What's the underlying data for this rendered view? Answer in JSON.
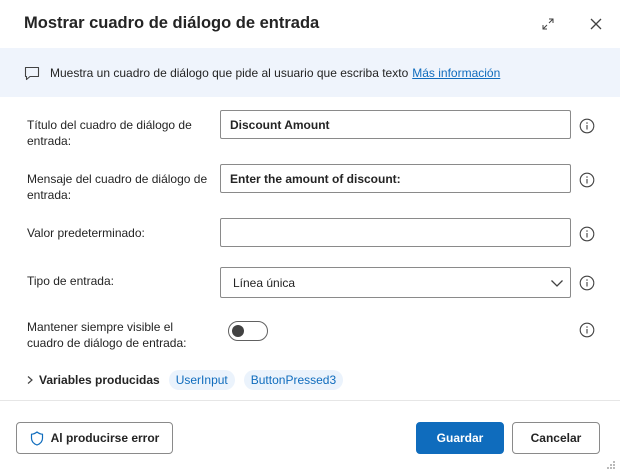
{
  "dialog": {
    "title": "Mostrar cuadro de diálogo de entrada",
    "expand_icon": "expand-icon",
    "close_icon": "close-icon"
  },
  "banner": {
    "icon": "comment-icon",
    "text": "Muestra un cuadro de diálogo que pide al usuario que escriba texto",
    "link": "Más información"
  },
  "fields": {
    "title": {
      "label": "Título del cuadro de diálogo de entrada:",
      "value": "Discount Amount"
    },
    "message": {
      "label": "Mensaje del cuadro de diálogo de entrada:",
      "value": "Enter the amount of discount:"
    },
    "default_value": {
      "label": "Valor predeterminado:",
      "value": ""
    },
    "input_type": {
      "label": "Tipo de entrada:",
      "value": "Línea única"
    },
    "keep_visible": {
      "label": "Mantener siempre visible el cuadro de diálogo de entrada:",
      "checked": false
    }
  },
  "variables": {
    "label": "Variables producidas",
    "items": [
      "UserInput",
      "ButtonPressed3"
    ]
  },
  "footer": {
    "on_error": "Al producirse error",
    "save": "Guardar",
    "cancel": "Cancelar"
  },
  "colors": {
    "accent": "#0f6cbd",
    "banner_bg": "#eff4fc",
    "pill_bg": "#ebf3fc"
  }
}
